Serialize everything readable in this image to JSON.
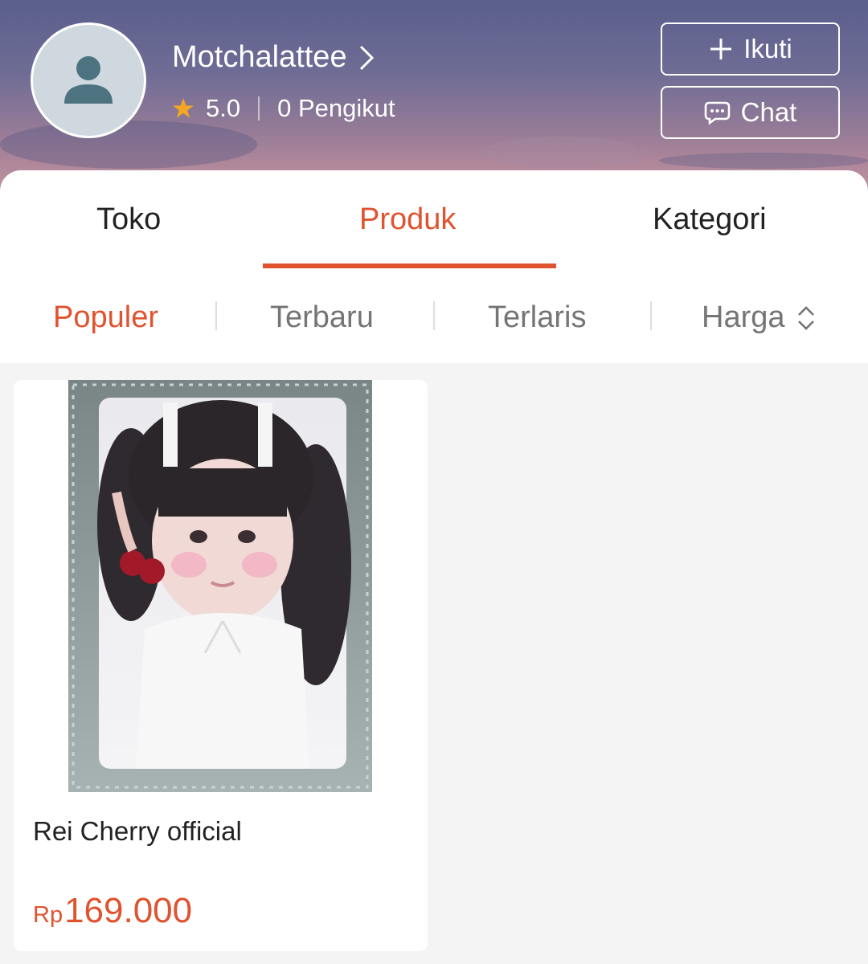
{
  "shop": {
    "name": "Motchalattee",
    "rating": "5.0",
    "followers": "0 Pengikut",
    "follow_label": "Ikuti",
    "chat_label": "Chat"
  },
  "tabs": [
    {
      "label": "Toko",
      "active": false
    },
    {
      "label": "Produk",
      "active": true
    },
    {
      "label": "Kategori",
      "active": false
    }
  ],
  "sort": [
    {
      "label": "Populer",
      "active": true
    },
    {
      "label": "Terbaru",
      "active": false
    },
    {
      "label": "Terlaris",
      "active": false
    },
    {
      "label": "Harga",
      "active": false
    }
  ],
  "products": [
    {
      "title": "Rei Cherry official",
      "currency": "Rp",
      "price": "169.000"
    }
  ],
  "colors": {
    "accent": "#e0532f",
    "star": "#f6a623"
  },
  "icons": [
    "avatar-placeholder-icon",
    "chevron-right-icon",
    "star-icon",
    "plus-icon",
    "chat-bubble-icon",
    "sort-arrows-icon"
  ]
}
